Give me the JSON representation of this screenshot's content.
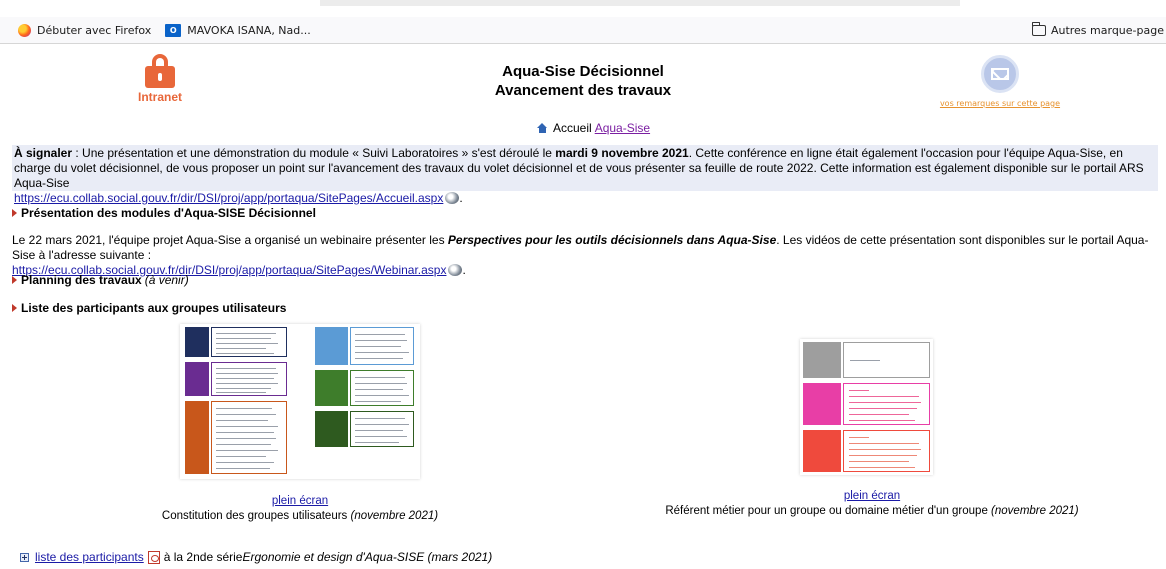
{
  "browser": {
    "bookmarks": [
      {
        "label": "Débuter avec Firefox",
        "icon": "firefox-icon"
      },
      {
        "label": "MAVOKA ISANA, Nad...",
        "icon": "outlook-icon"
      }
    ],
    "other_bookmarks": "Autres marque-page"
  },
  "header": {
    "intranet_label": "Intranet",
    "title_line1": "Aqua-Sise Décisionnel",
    "title_line2": "Avancement des travaux",
    "feedback_link": "vos remarques sur cette page"
  },
  "breadcrumb": {
    "prefix": "Accueil",
    "link": "Aqua-Sise"
  },
  "notice": {
    "label": "À signaler",
    "text1": " : Une présentation et une démonstration du module « Suivi Laboratoires » s'est déroulé le ",
    "date": "mardi 9 novembre 2021",
    "text2": ". Cette conférence en ligne était également l'occasion pour l'équipe Aqua-Sise, en charge du volet décisionnel, de vous proposer un point sur l'avancement des travaux du volet décisionnel et de vous présenter sa feuille de route 2022. Cette information est également disponible sur le portail ARS Aqua-Sise",
    "url": "https://ecu.collab.social.gouv.fr/dir/DSI/proj/app/portaqua/SitePages/Accueil.aspx"
  },
  "sections": {
    "presentation": "Présentation des modules d'Aqua-SISE Décisionnel",
    "planning": "Planning des travaux",
    "planning_note": "(à venir)",
    "participants": "Liste des participants aux groupes utilisateurs"
  },
  "webinar": {
    "text1": "Le 22 mars 2021, l'équipe projet Aqua-Sise a organisé un webinaire présenter les ",
    "emph": "Perspectives pour les outils décisionnels dans Aqua-Sise",
    "text2": ". Les vidéos de cette présentation sont disponibles sur le portail Aqua-Sise à l'adresse suivante :",
    "url": "https://ecu.collab.social.gouv.fr/dir/DSI/proj/app/portaqua/SitePages/Webinar.aspx"
  },
  "figures": [
    {
      "link": "plein écran",
      "caption": "Constitution des groupes utilisateurs ",
      "date": "(novembre 2021)"
    },
    {
      "link": "plein écran",
      "caption": "Référent métier pour un groupe ou domaine métier d'un groupe ",
      "date": "(novembre 2021)"
    }
  ],
  "bottom": {
    "link": "liste des participants",
    "text": " à la 2nde série ",
    "emph": "Ergonomie et design d'Aqua-SISE (mars 2021)"
  },
  "colors": {
    "accent_orange": "#e8673a",
    "link_blue": "#1a1aa6",
    "notice_bg": "#e9ecf6",
    "navy": "#1f2f5e",
    "purple": "#6a2c91",
    "rust": "#c8571b",
    "light_blue": "#5b9bd5",
    "green": "#3e7d2b",
    "dark_green": "#2e5a1f",
    "gray": "#9e9e9e",
    "magenta": "#e83ea6",
    "red": "#ef4a3d"
  }
}
